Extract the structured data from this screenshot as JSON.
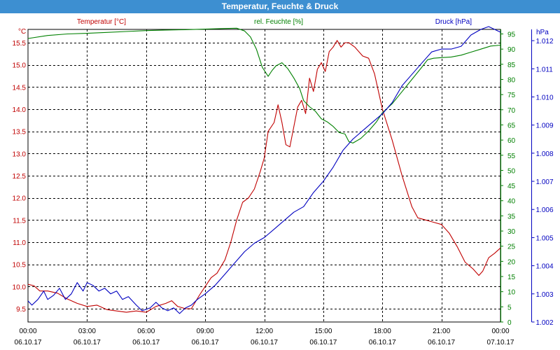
{
  "window": {
    "title": "Temperatur, Feuchte & Druck"
  },
  "chart_data": {
    "type": "line",
    "title": "Temperatur, Feuchte & Druck",
    "grid": true,
    "colors": {
      "temperature": "#c00000",
      "humidity": "#008000",
      "pressure": "#0000c0"
    },
    "x_ticks": [
      {
        "time": "00:00",
        "date": "06.10.17"
      },
      {
        "time": "03:00",
        "date": "06.10.17"
      },
      {
        "time": "06:00",
        "date": "06.10.17"
      },
      {
        "time": "09:00",
        "date": "06.10.17"
      },
      {
        "time": "12:00",
        "date": "06.10.17"
      },
      {
        "time": "15:00",
        "date": "06.10.17"
      },
      {
        "time": "18:00",
        "date": "06.10.17"
      },
      {
        "time": "21:00",
        "date": "06.10.17"
      },
      {
        "time": "00:00",
        "date": "07.10.17"
      }
    ],
    "x_unit": "hours since 06.10.17 00:00",
    "axes": {
      "temperature": {
        "label": "Temperatur [°C]",
        "unit": "°C",
        "ylim": [
          9.2,
          15.8
        ],
        "ticks": [
          9.5,
          10.0,
          10.5,
          11.0,
          11.5,
          12.0,
          12.5,
          13.0,
          13.5,
          14.0,
          14.5,
          15.0,
          15.5
        ],
        "tick_labels": [
          "9.5",
          "10.0",
          "10.5",
          "11.0",
          "11.5",
          "12.0",
          "12.5",
          "13.0",
          "13.5",
          "14.0",
          "14.5",
          "15.0",
          "15.5"
        ]
      },
      "humidity": {
        "label": "rel. Feuchte [%]",
        "unit": "%",
        "ylim": [
          0,
          96.5
        ],
        "ticks": [
          0,
          5,
          10,
          15,
          20,
          25,
          30,
          35,
          40,
          45,
          50,
          55,
          60,
          65,
          70,
          75,
          80,
          85,
          90,
          95
        ],
        "tick_labels": [
          "0",
          "5",
          "10",
          "15",
          "20",
          "25",
          "30",
          "35",
          "40",
          "45",
          "50",
          "55",
          "60",
          "65",
          "70",
          "75",
          "80",
          "85",
          "90",
          "95"
        ]
      },
      "pressure": {
        "label": "Druck [hPa]",
        "unit": "hPa",
        "ylim": [
          1.002,
          1.0124
        ],
        "ticks": [
          1.002,
          1.003,
          1.004,
          1.005,
          1.006,
          1.007,
          1.008,
          1.009,
          1.01,
          1.011,
          1.012
        ],
        "tick_labels": [
          "1.002",
          "1.003",
          "1.004",
          "1.005",
          "1.006",
          "1.007",
          "1.008",
          "1.009",
          "1.010",
          "1.011",
          "1.012"
        ]
      }
    },
    "series": [
      {
        "name": "Temperatur [°C]",
        "axis": "temperature",
        "points": [
          [
            0,
            10.05
          ],
          [
            0.3,
            10.02
          ],
          [
            0.6,
            9.9
          ],
          [
            1,
            9.9
          ],
          [
            1.5,
            9.85
          ],
          [
            2,
            9.72
          ],
          [
            2.5,
            9.62
          ],
          [
            3,
            9.55
          ],
          [
            3.5,
            9.58
          ],
          [
            4,
            9.48
          ],
          [
            4.5,
            9.45
          ],
          [
            5,
            9.42
          ],
          [
            5.5,
            9.45
          ],
          [
            6,
            9.42
          ],
          [
            6.5,
            9.55
          ],
          [
            7,
            9.62
          ],
          [
            7.3,
            9.68
          ],
          [
            7.6,
            9.55
          ],
          [
            8,
            9.5
          ],
          [
            8.3,
            9.5
          ],
          [
            8.7,
            9.8
          ],
          [
            9,
            10.0
          ],
          [
            9.3,
            10.2
          ],
          [
            9.6,
            10.3
          ],
          [
            10,
            10.6
          ],
          [
            10.3,
            11.0
          ],
          [
            10.6,
            11.5
          ],
          [
            10.9,
            11.9
          ],
          [
            11.2,
            12.0
          ],
          [
            11.5,
            12.2
          ],
          [
            11.8,
            12.6
          ],
          [
            12,
            12.9
          ],
          [
            12.2,
            13.5
          ],
          [
            12.5,
            13.7
          ],
          [
            12.7,
            14.1
          ],
          [
            12.9,
            13.7
          ],
          [
            13.1,
            13.2
          ],
          [
            13.3,
            13.15
          ],
          [
            13.5,
            13.6
          ],
          [
            13.7,
            14.05
          ],
          [
            13.9,
            14.2
          ],
          [
            14.1,
            13.9
          ],
          [
            14.3,
            14.7
          ],
          [
            14.5,
            14.4
          ],
          [
            14.7,
            14.9
          ],
          [
            14.9,
            15.05
          ],
          [
            15.1,
            14.85
          ],
          [
            15.3,
            15.3
          ],
          [
            15.5,
            15.4
          ],
          [
            15.7,
            15.55
          ],
          [
            15.9,
            15.4
          ],
          [
            16.1,
            15.5
          ],
          [
            16.3,
            15.5
          ],
          [
            16.6,
            15.4
          ],
          [
            17,
            15.2
          ],
          [
            17.3,
            15.15
          ],
          [
            17.6,
            14.8
          ],
          [
            18,
            14.0
          ],
          [
            18.5,
            13.3
          ],
          [
            19,
            12.5
          ],
          [
            19.5,
            11.8
          ],
          [
            19.8,
            11.55
          ],
          [
            20.2,
            11.5
          ],
          [
            20.6,
            11.45
          ],
          [
            21,
            11.4
          ],
          [
            21.4,
            11.2
          ],
          [
            21.8,
            10.9
          ],
          [
            22.2,
            10.55
          ],
          [
            22.6,
            10.4
          ],
          [
            22.9,
            10.25
          ],
          [
            23.1,
            10.35
          ],
          [
            23.4,
            10.65
          ],
          [
            23.7,
            10.75
          ],
          [
            24,
            10.87
          ]
        ]
      },
      {
        "name": "rel. Feuchte [%]",
        "axis": "humidity",
        "points": [
          [
            0,
            93.5
          ],
          [
            1,
            94.5
          ],
          [
            2,
            95.0
          ],
          [
            3,
            95.2
          ],
          [
            4,
            95.5
          ],
          [
            5,
            95.8
          ],
          [
            6,
            96.1
          ],
          [
            7,
            96.3
          ],
          [
            8,
            96.4
          ],
          [
            9,
            96.6
          ],
          [
            10,
            96.8
          ],
          [
            10.6,
            96.9
          ],
          [
            11,
            96.0
          ],
          [
            11.3,
            94.0
          ],
          [
            11.6,
            90.0
          ],
          [
            11.9,
            84.0
          ],
          [
            12.2,
            81.0
          ],
          [
            12.4,
            83.0
          ],
          [
            12.6,
            84.5
          ],
          [
            12.9,
            85.5
          ],
          [
            13.2,
            83.5
          ],
          [
            13.5,
            80.5
          ],
          [
            13.8,
            77.0
          ],
          [
            14,
            73.0
          ],
          [
            14.3,
            71.0
          ],
          [
            14.6,
            69.5
          ],
          [
            14.9,
            67.0
          ],
          [
            15.2,
            66.0
          ],
          [
            15.5,
            64.5
          ],
          [
            15.8,
            62.5
          ],
          [
            16.1,
            62.0
          ],
          [
            16.3,
            59.5
          ],
          [
            16.5,
            59.0
          ],
          [
            16.9,
            60.5
          ],
          [
            17.3,
            63.0
          ],
          [
            17.7,
            66.0
          ],
          [
            18,
            69.0
          ],
          [
            18.5,
            72.0
          ],
          [
            19,
            76.0
          ],
          [
            19.5,
            80.0
          ],
          [
            20,
            84.0
          ],
          [
            20.3,
            86.5
          ],
          [
            20.6,
            87.0
          ],
          [
            21,
            87.2
          ],
          [
            21.5,
            87.4
          ],
          [
            22,
            88.0
          ],
          [
            22.5,
            89.0
          ],
          [
            23,
            90.0
          ],
          [
            23.5,
            91.0
          ],
          [
            24,
            91.3
          ]
        ]
      },
      {
        "name": "Druck [hPa]",
        "axis": "pressure",
        "points": [
          [
            0,
            1.00275
          ],
          [
            0.2,
            1.0026
          ],
          [
            0.5,
            1.0028
          ],
          [
            0.8,
            1.0031
          ],
          [
            1,
            1.0028
          ],
          [
            1.3,
            1.00295
          ],
          [
            1.6,
            1.0032
          ],
          [
            1.9,
            1.0028
          ],
          [
            2.2,
            1.003
          ],
          [
            2.5,
            1.0034
          ],
          [
            2.8,
            1.0031
          ],
          [
            3,
            1.0034
          ],
          [
            3.3,
            1.0033
          ],
          [
            3.6,
            1.0031
          ],
          [
            3.9,
            1.0032
          ],
          [
            4.2,
            1.003
          ],
          [
            4.5,
            1.0031
          ],
          [
            4.8,
            1.0028
          ],
          [
            5.1,
            1.0029
          ],
          [
            5.5,
            1.0026
          ],
          [
            5.8,
            1.0024
          ],
          [
            6.2,
            1.0025
          ],
          [
            6.5,
            1.0027
          ],
          [
            6.8,
            1.0025
          ],
          [
            7.1,
            1.0024
          ],
          [
            7.4,
            1.0025
          ],
          [
            7.7,
            1.0023
          ],
          [
            8,
            1.0025
          ],
          [
            8.3,
            1.0026
          ],
          [
            8.6,
            1.0028
          ],
          [
            9,
            1.003
          ],
          [
            9.5,
            1.0033
          ],
          [
            10,
            1.0037
          ],
          [
            10.5,
            1.0041
          ],
          [
            11,
            1.0045
          ],
          [
            11.5,
            1.0048
          ],
          [
            12,
            1.005
          ],
          [
            12.5,
            1.0053
          ],
          [
            13,
            1.0056
          ],
          [
            13.5,
            1.0059
          ],
          [
            14,
            1.0061
          ],
          [
            14.5,
            1.0066
          ],
          [
            15,
            1.007
          ],
          [
            15.5,
            1.0075
          ],
          [
            16,
            1.0081
          ],
          [
            16.5,
            1.0085
          ],
          [
            17,
            1.0088
          ],
          [
            17.5,
            1.0091
          ],
          [
            18,
            1.0094
          ],
          [
            18.5,
            1.0098
          ],
          [
            19,
            1.0104
          ],
          [
            19.5,
            1.0108
          ],
          [
            20,
            1.0112
          ],
          [
            20.5,
            1.0116
          ],
          [
            21,
            1.0117
          ],
          [
            21.5,
            1.0117
          ],
          [
            22,
            1.0118
          ],
          [
            22.5,
            1.0122
          ],
          [
            23,
            1.0124
          ],
          [
            23.4,
            1.0125
          ],
          [
            23.7,
            1.0124
          ],
          [
            24,
            1.0123
          ]
        ]
      }
    ]
  }
}
